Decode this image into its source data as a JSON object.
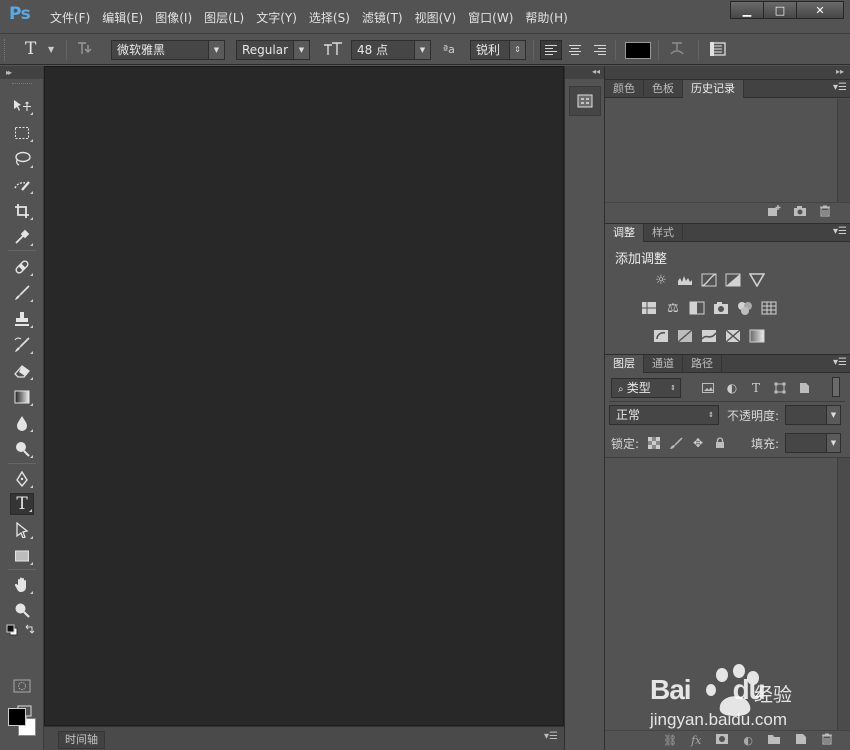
{
  "app": {
    "logo": "Ps",
    "menu": [
      "文件(F)",
      "编辑(E)",
      "图像(I)",
      "图层(L)",
      "文字(Y)",
      "选择(S)",
      "滤镜(T)",
      "视图(V)",
      "窗口(W)",
      "帮助(H)"
    ],
    "window_buttons": {
      "minimize": "▁",
      "maximize": "□",
      "close": "✕"
    }
  },
  "options": {
    "tool_icon": "T",
    "font_family": "微软雅黑",
    "font_style": "Regular",
    "font_size": "48 点",
    "aa_label": "ªa",
    "antialias": "锐利",
    "text_color": "#000000"
  },
  "toolbox": {
    "icons": [
      "move-icon",
      "marquee-icon",
      "lasso-icon",
      "quick-selection-icon",
      "crop-icon",
      "eyedropper-icon",
      "healing-brush-icon",
      "brush-icon",
      "clone-stamp-icon",
      "history-brush-icon",
      "eraser-icon",
      "gradient-icon",
      "blur-icon",
      "dodge-icon",
      "pen-icon",
      "type-icon",
      "path-selection-icon",
      "rectangle-icon",
      "hand-icon",
      "zoom-icon"
    ],
    "active_tool": "type-icon",
    "foreground": "#000000",
    "background": "#ffffff"
  },
  "timeline": {
    "tab": "时间轴"
  },
  "panels": {
    "group1": {
      "tabs": [
        "颜色",
        "色板",
        "历史记录"
      ],
      "active": 2
    },
    "group2": {
      "tabs": [
        "调整",
        "样式"
      ],
      "active": 0,
      "title": "添加调整"
    },
    "group3": {
      "tabs": [
        "图层",
        "通道",
        "路径"
      ],
      "active": 0,
      "filter_kind": "类型",
      "blend_mode": "正常",
      "opacity_label": "不透明度:",
      "lock_label": "锁定:",
      "fill_label": "填充:"
    }
  },
  "watermark": {
    "brand_a": "Bai",
    "brand_b": "du",
    "brand_cn": "经验",
    "url": "jingyan.baidu.com"
  }
}
